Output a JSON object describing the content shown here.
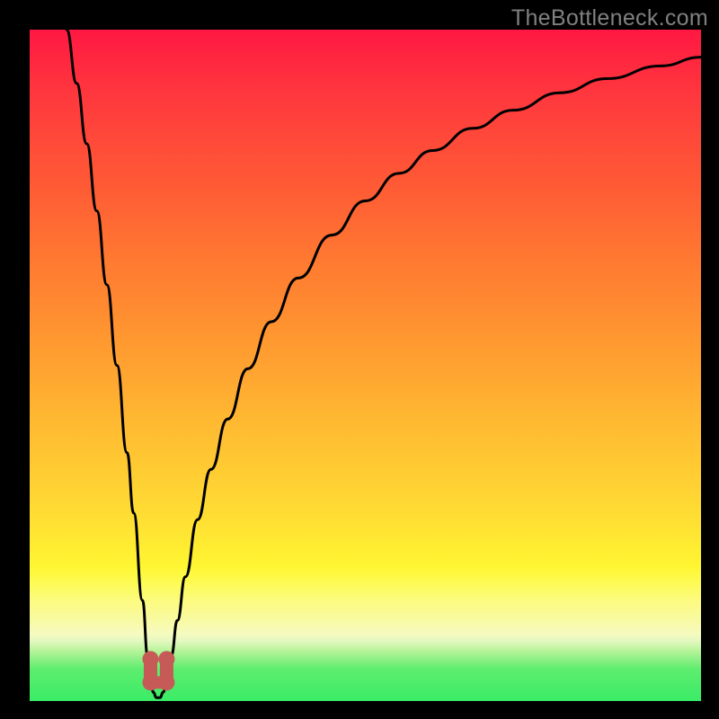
{
  "watermark": "TheBottleneck.com",
  "chart_data": {
    "type": "line",
    "title": "",
    "xlabel": "",
    "ylabel": "",
    "xlim": [
      0,
      100
    ],
    "ylim": [
      0,
      100
    ],
    "curve": {
      "name": "bottleneck",
      "points": [
        [
          5.5,
          100.0
        ],
        [
          7.0,
          92.0
        ],
        [
          8.5,
          83.0
        ],
        [
          10.0,
          73.0
        ],
        [
          11.5,
          62.0
        ],
        [
          13.0,
          50.0
        ],
        [
          14.5,
          37.0
        ],
        [
          15.5,
          28.0
        ],
        [
          16.8,
          15.0
        ],
        [
          17.6,
          6.5
        ],
        [
          18.1,
          3.0
        ],
        [
          18.4,
          1.3
        ],
        [
          18.9,
          0.5
        ],
        [
          19.4,
          0.5
        ],
        [
          19.9,
          1.3
        ],
        [
          20.4,
          3.3
        ],
        [
          21.1,
          6.8
        ],
        [
          22.0,
          12.0
        ],
        [
          23.2,
          18.5
        ],
        [
          25.0,
          27.0
        ],
        [
          27.0,
          34.5
        ],
        [
          29.5,
          42.0
        ],
        [
          32.5,
          49.5
        ],
        [
          36.0,
          56.5
        ],
        [
          40.0,
          63.0
        ],
        [
          45.0,
          69.4
        ],
        [
          50.0,
          74.5
        ],
        [
          55.0,
          78.6
        ],
        [
          60.0,
          82.0
        ],
        [
          66.0,
          85.3
        ],
        [
          72.0,
          88.0
        ],
        [
          79.0,
          90.6
        ],
        [
          86.0,
          92.7
        ],
        [
          94.0,
          94.6
        ],
        [
          100.0,
          95.9
        ]
      ]
    },
    "valley_markers": [
      {
        "x": 18.0,
        "y": 3.3
      },
      {
        "x": 20.4,
        "y": 3.3
      }
    ],
    "marker_color": "#c55a57",
    "curve_color": "#000000"
  }
}
